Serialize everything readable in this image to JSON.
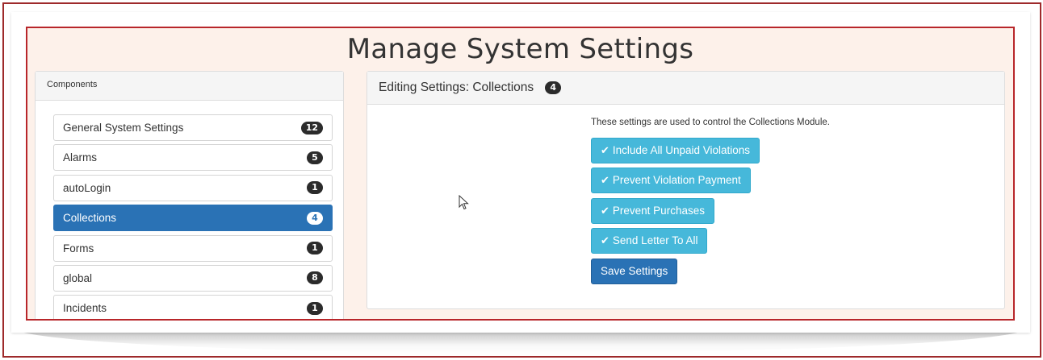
{
  "page_title": "Manage System Settings",
  "components_panel": {
    "heading": "Components",
    "items": [
      {
        "label": "General System Settings",
        "count": "12"
      },
      {
        "label": "Alarms",
        "count": "5"
      },
      {
        "label": "autoLogin",
        "count": "1"
      },
      {
        "label": "Collections",
        "count": "4",
        "active": true
      },
      {
        "label": "Forms",
        "count": "1"
      },
      {
        "label": "global",
        "count": "8"
      },
      {
        "label": "Incidents",
        "count": "1"
      }
    ]
  },
  "editing_panel": {
    "heading": "Editing Settings: Collections",
    "count": "4",
    "description": "These settings are used to control the Collections Module.",
    "toggles": [
      {
        "label": "Include All Unpaid Violations",
        "checked": true
      },
      {
        "label": "Prevent Violation Payment",
        "checked": true
      },
      {
        "label": "Prevent Purchases",
        "checked": true
      },
      {
        "label": "Send Letter To All",
        "checked": true
      }
    ],
    "save_label": "Save Settings",
    "check_icon": "check-icon"
  },
  "colors": {
    "frame_red": "#b8262a",
    "active_blue": "#2a72b5",
    "toggle_cyan": "#46b8da",
    "badge_dark": "#2b2b2b",
    "title_bg": "#fdf1ea"
  }
}
